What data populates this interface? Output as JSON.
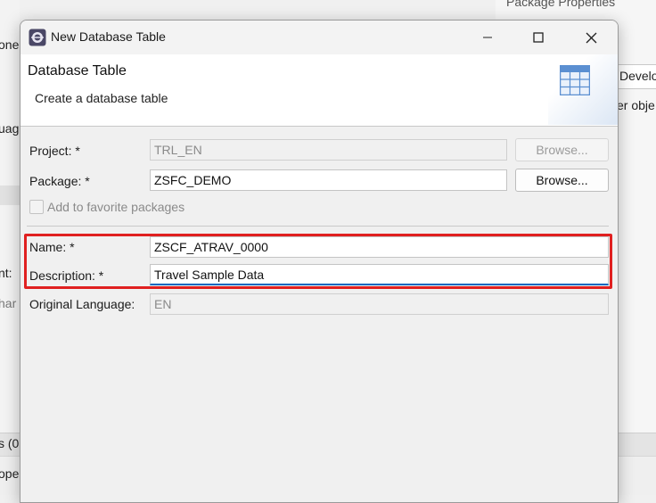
{
  "background": {
    "left_fragments": [
      "one",
      "uag",
      "nt:",
      "har",
      "s (0",
      "ope"
    ],
    "right_fragments": [
      "Package Properties",
      "Develo",
      "er obje"
    ]
  },
  "dialog": {
    "title": "New Database Table",
    "header": {
      "title": "Database Table",
      "description": "Create a database table"
    },
    "form": {
      "project": {
        "label": "Project: *",
        "value": "TRL_EN",
        "browse": "Browse..."
      },
      "package": {
        "label": "Package: *",
        "value": "ZSFC_DEMO",
        "browse": "Browse..."
      },
      "favorite": {
        "label": "Add to favorite packages",
        "checked": false
      },
      "name": {
        "label": "Name: *",
        "value": "ZSCF_ATRAV_0000"
      },
      "description": {
        "label": "Description: *",
        "value": "Travel Sample Data"
      },
      "original_language": {
        "label": "Original Language:",
        "value": "EN"
      }
    }
  },
  "colors": {
    "highlight": "#e02020",
    "focus": "#0067c0"
  }
}
